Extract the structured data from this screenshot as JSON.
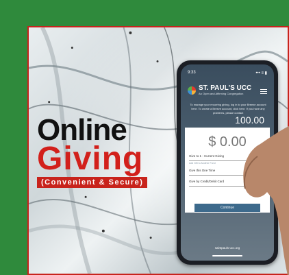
{
  "poster": {
    "title_line1": "Online",
    "title_line2": "Giving",
    "subtitle": "(Convenient & Secure)"
  },
  "phone": {
    "time": "9:33",
    "status_icons": "••• ≡ ▮",
    "brand_name": "ST. PAUL'S UCC",
    "brand_tagline": "An Open and Affirming Congregation",
    "intro_text": "To manage your recurring giving, log in to your Breeze account here. To create a Breeze account, click here. If you have any problems, please contact",
    "amount_background": "100.00",
    "amount": "$ 0.00",
    "give_to_field": "Give to 1 - Current Giving",
    "give_to_hint": "Add Gift to Another Fund",
    "frequency_field": "Give this One Time",
    "method_field": "Give by Credit/Debit Card",
    "continue_label": "Continue",
    "footer_link": "saintpauls-ucc.org"
  },
  "colors": {
    "frame_green": "#2f8a3c",
    "accent_red": "#c8231c",
    "title_black": "#111111"
  }
}
